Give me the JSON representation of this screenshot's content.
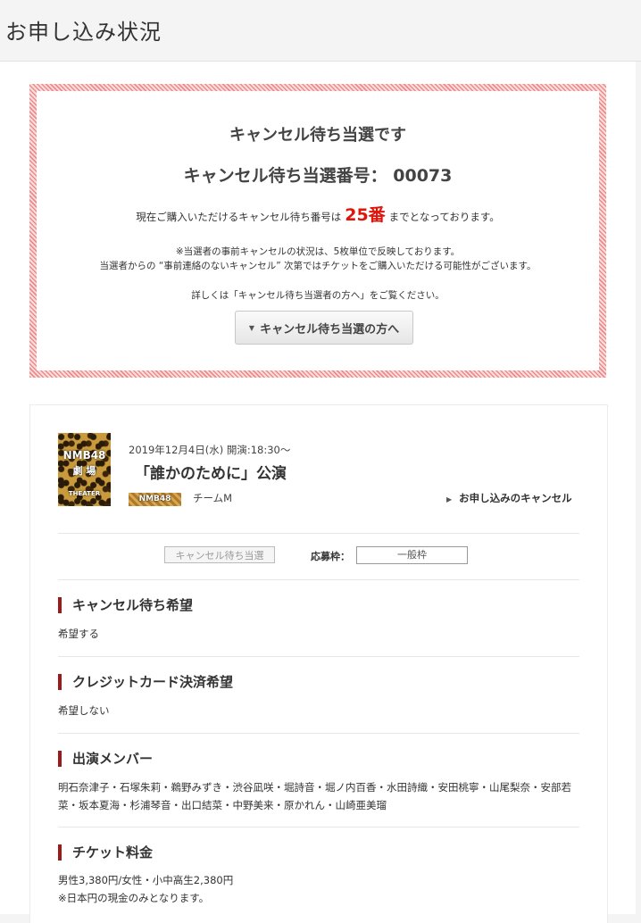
{
  "page": {
    "title": "お申し込み状況"
  },
  "notice": {
    "heading": "キャンセル待ち当選です",
    "number_line": "キャンセル待ち当選番号： 00073",
    "purchase_prefix": "現在ご購入いただけるキャンセル待ち番号は",
    "purchase_number": "25番",
    "purchase_suffix": "までとなっております。",
    "note_line1": "※当選者の事前キャンセルの状況は、5枚単位で反映しております。",
    "note_line2": "当選者からの “事前連絡のないキャンセル” 次第ではチケットをご購入いただける可能性がございます。",
    "detail_line": "詳しくは「キャンセル待ち当選者の方へ」をご覧ください。",
    "button_label": "キャンセル待ち当選の方へ"
  },
  "event": {
    "date": "2019年12月4日(水) 開演:18:30〜",
    "title": "「誰かのために」公演",
    "team": "チームM",
    "cancel_link": "お申し込みのキャンセル",
    "logo_text": "NMB48",
    "theater_logo": {
      "line1": "NMB48",
      "line2": "劇 場",
      "line3": "THEATER"
    },
    "status_badge": "キャンセル待ち当選",
    "quota_label": "応募枠：",
    "quota_value": "一般枠"
  },
  "sections": {
    "waitlist": {
      "heading": "キャンセル待ち希望",
      "value": "希望する"
    },
    "credit": {
      "heading": "クレジットカード決済希望",
      "value": "希望しない"
    },
    "members": {
      "heading": "出演メンバー",
      "value": "明石奈津子・石塚朱莉・鵜野みずき・渋谷凪咲・堀詩音・堀ノ内百香・水田詩織・安田桃寧・山尾梨奈・安部若菜・坂本夏海・杉浦琴音・出口結菜・中野美来・原かれん・山崎亜美瑠"
    },
    "price": {
      "heading": "チケット料金",
      "line1": "男性3,380円/女性・小中高生2,380円",
      "line2": "※日本円の現金のみとなります。"
    }
  },
  "colors": {
    "accent": "#9b1a1a",
    "highlight": "#e0140a",
    "border_stripe": "#ef8a8a"
  },
  "icons": {
    "button_caret": "caret-down-icon",
    "cancel_arrow": "caret-right-icon"
  }
}
